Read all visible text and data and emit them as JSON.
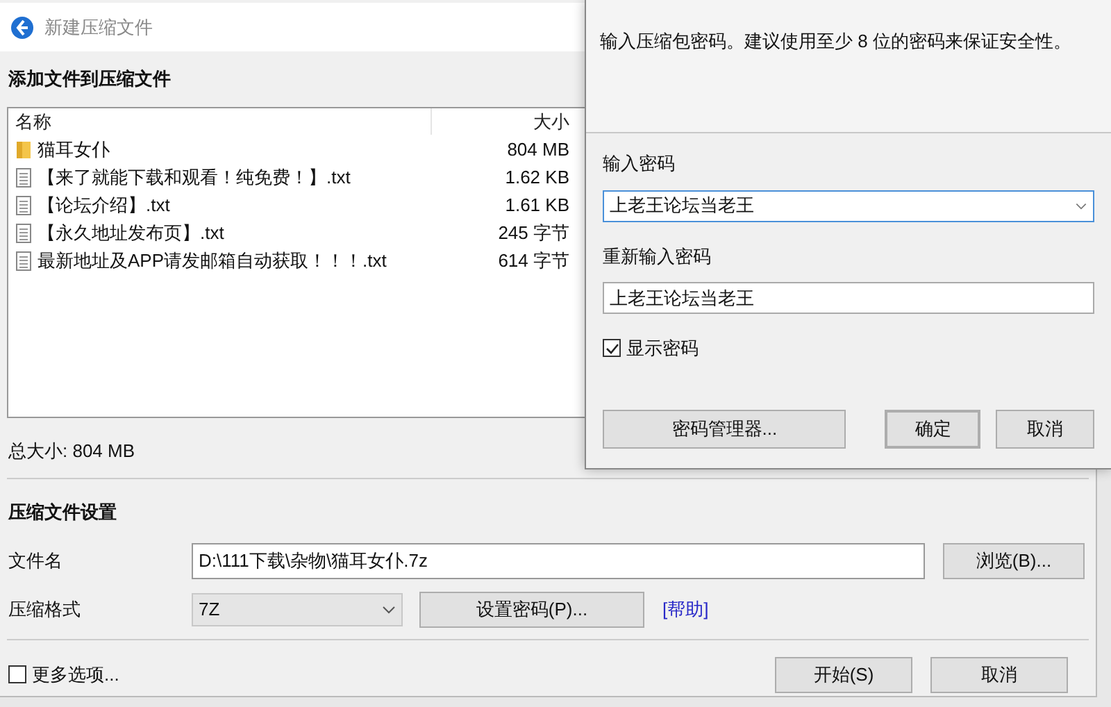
{
  "window": {
    "title": "新建压缩文件"
  },
  "add_section": {
    "heading": "添加文件到压缩文件"
  },
  "file_list": {
    "columns": [
      "名称",
      "大小"
    ],
    "rows": [
      {
        "kind": "folder",
        "name": "猫耳女仆",
        "size": "804 MB"
      },
      {
        "kind": "file",
        "name": "【来了就能下载和观看！纯免费！】.txt",
        "size": "1.62 KB"
      },
      {
        "kind": "file",
        "name": "【论坛介绍】.txt",
        "size": "1.61 KB"
      },
      {
        "kind": "file",
        "name": "【永久地址发布页】.txt",
        "size": "245 字节"
      },
      {
        "kind": "file",
        "name": "最新地址及APP请发邮箱自动获取！！！.txt",
        "size": "614 字节"
      }
    ]
  },
  "total_size": "总大小: 804 MB",
  "settings": {
    "heading": "压缩文件设置",
    "filename_label": "文件名",
    "filename_value": "D:\\111下载\\杂物\\猫耳女仆.7z",
    "browse_button": "浏览(B)...",
    "format_label": "压缩格式",
    "format_value": "7Z",
    "password_button": "设置密码(P)...",
    "help_link": "[帮助]"
  },
  "more_options": {
    "label": "更多选项...",
    "checked": false
  },
  "buttons": [
    "开始(S)",
    "取消"
  ],
  "password_dialog": {
    "hint": "输入压缩包密码。建议使用至少 8 位的密码来保证安全性。",
    "password_label": "输入密码",
    "password_value": "上老王论坛当老王",
    "confirm_label": "重新输入密码",
    "confirm_value": "上老王论坛当老王",
    "show_password": {
      "label": "显示密码",
      "checked": true
    },
    "manager_button": "密码管理器...",
    "ok_button": "确定",
    "cancel_button": "取消"
  }
}
